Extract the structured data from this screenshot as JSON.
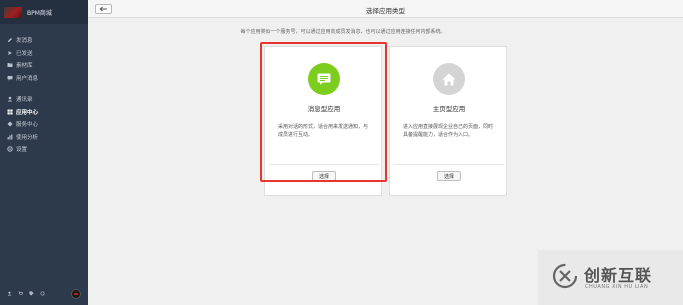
{
  "brand": {
    "title": "BPM商城"
  },
  "sidebar": {
    "group1": [
      {
        "label": "发消息",
        "icon": "pen-icon"
      },
      {
        "label": "已发送",
        "icon": "send-icon"
      },
      {
        "label": "素材库",
        "icon": "folder-icon"
      },
      {
        "label": "用户消息",
        "icon": "chat-icon"
      }
    ],
    "group2": [
      {
        "label": "通讯录",
        "icon": "contacts-icon"
      },
      {
        "label": "应用中心",
        "icon": "app-icon",
        "active": true
      },
      {
        "label": "服务中心",
        "icon": "service-icon"
      },
      {
        "label": "使用分析",
        "icon": "chart-icon"
      },
      {
        "label": "设置",
        "icon": "gear-icon"
      }
    ],
    "footer_icons": [
      "user-icon",
      "cart-icon",
      "tag-icon",
      "refresh-icon"
    ]
  },
  "topbar": {
    "back_icon": "arrow-left-icon",
    "title": "选择应用类型"
  },
  "main": {
    "hint": "每个应用类似一个服务号，可以通过应用向成员发消息，也可以通过应用连接任何内部系统。",
    "cards": [
      {
        "title": "消息型应用",
        "desc": "采用对话的形式，适合用来发送通知，与成员进行互动。",
        "button": "选择",
        "icon": "message-icon",
        "color": "#7ccd1e"
      },
      {
        "title": "主页型应用",
        "desc": "进入应用直接展现企业自己的页面，同时具备提醒能力，适合作为入口。",
        "button": "选择",
        "icon": "home-icon",
        "color": "#d4d4d4"
      }
    ]
  },
  "highlight_color": "#e8352f",
  "watermark": {
    "name": "创新互联",
    "sub": "CHUANG XIN HU LIAN"
  }
}
